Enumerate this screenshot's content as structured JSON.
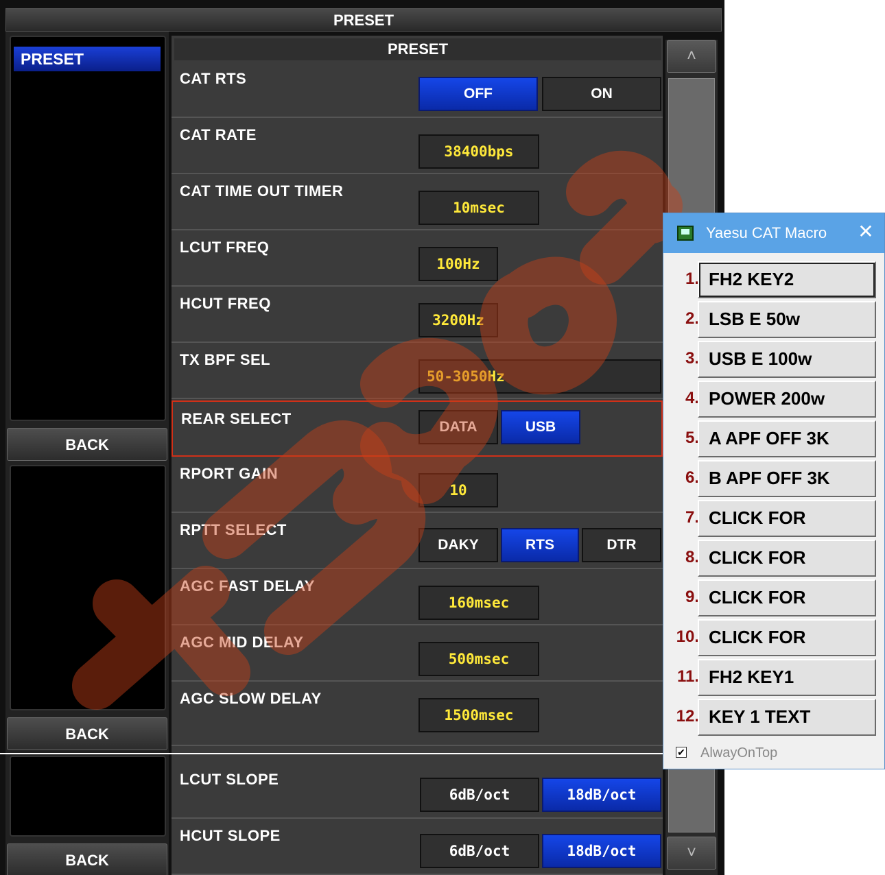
{
  "window": {
    "title": "PRESET"
  },
  "left": {
    "selected_item": "PRESET",
    "back_label": "BACK"
  },
  "main": {
    "header": "PRESET",
    "rows": [
      {
        "label": "CAT RTS",
        "options": [
          "OFF",
          "ON"
        ],
        "selected": "OFF"
      },
      {
        "label": "CAT RATE",
        "value": "38400bps"
      },
      {
        "label": "CAT TIME OUT TIMER",
        "value": "10msec"
      },
      {
        "label": "LCUT FREQ",
        "value": "100Hz"
      },
      {
        "label": "HCUT FREQ",
        "value": "3200Hz"
      },
      {
        "label": "TX BPF SEL",
        "value": "50-3050Hz"
      },
      {
        "label": "REAR SELECT",
        "options": [
          "DATA",
          "USB"
        ],
        "selected": "USB"
      },
      {
        "label": "RPORT GAIN",
        "value": "10"
      },
      {
        "label": "RPTT SELECT",
        "options": [
          "DAKY",
          "RTS",
          "DTR"
        ],
        "selected": "RTS"
      },
      {
        "label": "AGC FAST DELAY",
        "value": "160msec"
      },
      {
        "label": "AGC MID DELAY",
        "value": "500msec"
      },
      {
        "label": "AGC SLOW DELAY",
        "value": "1500msec"
      },
      {
        "label": "LCUT SLOPE",
        "options": [
          "6dB/oct",
          "18dB/oct"
        ],
        "selected": "18dB/oct"
      },
      {
        "label": "HCUT SLOPE",
        "options": [
          "6dB/oct",
          "18dB/oct"
        ],
        "selected": "18dB/oct"
      }
    ]
  },
  "macro": {
    "title": "Yaesu CAT Macro",
    "close_glyph": "✕",
    "buttons": [
      {
        "num": "1.",
        "label": "FH2 KEY2"
      },
      {
        "num": "2.",
        "label": "LSB E 50w"
      },
      {
        "num": "3.",
        "label": "USB E 100w"
      },
      {
        "num": "4.",
        "label": "POWER 200w"
      },
      {
        "num": "5.",
        "label": "A APF OFF 3K"
      },
      {
        "num": "6.",
        "label": "B APF OFF 3K"
      },
      {
        "num": "7.",
        "label": "CLICK FOR"
      },
      {
        "num": "8.",
        "label": "CLICK FOR"
      },
      {
        "num": "9.",
        "label": "CLICK FOR"
      },
      {
        "num": "10.",
        "label": "CLICK FOR"
      },
      {
        "num": "11.",
        "label": "FH2 KEY1"
      },
      {
        "num": "12.",
        "label": "KEY 1 TEXT"
      }
    ],
    "always_on_top": {
      "label": "AlwayOnTop",
      "checked": true
    }
  },
  "icons": {
    "scroll_up": "chevron-up-icon",
    "scroll_down": "chevron-down-icon",
    "macro_app": "app-icon",
    "close": "close-icon"
  },
  "colors": {
    "accent_blue": "#1546e8",
    "value_yellow": "#ffe93a",
    "highlight_red": "#d03018",
    "macro_title": "#5aa3e6",
    "macro_number": "#8a0f0f"
  }
}
